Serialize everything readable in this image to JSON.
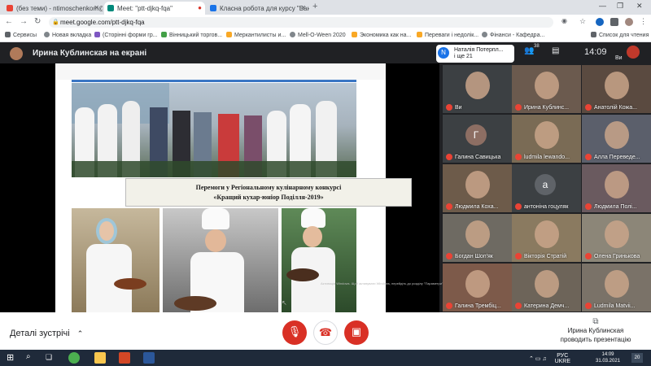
{
  "tabs": [
    {
      "title": "(без теми) - ntimoschenkom@g",
      "color": "#ea4335"
    },
    {
      "title": "Meet: \"ptt-djkq-fqa\"",
      "color": "#00897b"
    },
    {
      "title": "Класна робота для курсу \"Бан",
      "color": "#1a73e8"
    }
  ],
  "url": "meet.google.com/ptt-djkq-fqa",
  "bookmarks": [
    "Сервисы",
    "Новая вкладка",
    "(Сторінні форми гр...",
    "Вінницький торгов...",
    "Меркантилисты и...",
    "Мell-O-Ween 2020",
    "Экономика как на...",
    "Переваги і недолік...",
    "Фінанси - Кафедра...",
    "Список для чтения"
  ],
  "presenter_title": "Ирина Кублинская на екрані",
  "slide": {
    "caption_line1": "Перемоги у Регіональному кулінарному конкурсі",
    "caption_line2": "«Кращий кухар-юніор Поділля-2019»",
    "watermark": "Активація Windows. Щоб активувати Windows, перейдіть до розділу \"Параметри\"."
  },
  "activity": {
    "name": "Наталія Потерпл...",
    "more": "і ще 21",
    "initial": "N"
  },
  "people_count": "38",
  "clock": "14:09",
  "me_label": "Ви",
  "participants": [
    {
      "name": "Ви",
      "bg": "#3c4043"
    },
    {
      "name": "Ирина Кублинс...",
      "bg": "#6b5a4e"
    },
    {
      "name": "Анатолій Кожа...",
      "bg": "#5a4a40"
    },
    {
      "name": "Галина Савицька",
      "bg": "#3c4043",
      "letter": "Г",
      "lcolor": "#8d6e63"
    },
    {
      "name": "ludmila lewando...",
      "bg": "#7a6b55"
    },
    {
      "name": "Алла Переведе...",
      "bg": "#5b5f6b"
    },
    {
      "name": "Людмила Коха...",
      "bg": "#6d5b4a"
    },
    {
      "name": "антоніна гоцуляк",
      "bg": "#3c4043",
      "letter": "а",
      "lcolor": "#5f6368"
    },
    {
      "name": "Людмила Полі...",
      "bg": "#6a5a5f"
    },
    {
      "name": "Богдан Шоп'як",
      "bg": "#6e6a62"
    },
    {
      "name": "Вікторія Стратій",
      "bg": "#8a7a60"
    },
    {
      "name": "Олена Гринькова",
      "bg": "#8c8678"
    },
    {
      "name": "Галина Трембіц...",
      "bg": "#7d5a4a"
    },
    {
      "name": "Катерина Демч...",
      "bg": "#6d6459"
    },
    {
      "name": "Ludmila Matvii...",
      "bg": "#7a7268"
    }
  ],
  "bottom": {
    "details": "Деталі зустрічі",
    "presenting_line1": "Ирина Кублинская",
    "presenting_line2": "проводить презентацію"
  },
  "taskbar": {
    "lang": "РУС",
    "lang2": "UKRE",
    "time": "14:09",
    "date": "31.03.2021",
    "notif": "20"
  }
}
